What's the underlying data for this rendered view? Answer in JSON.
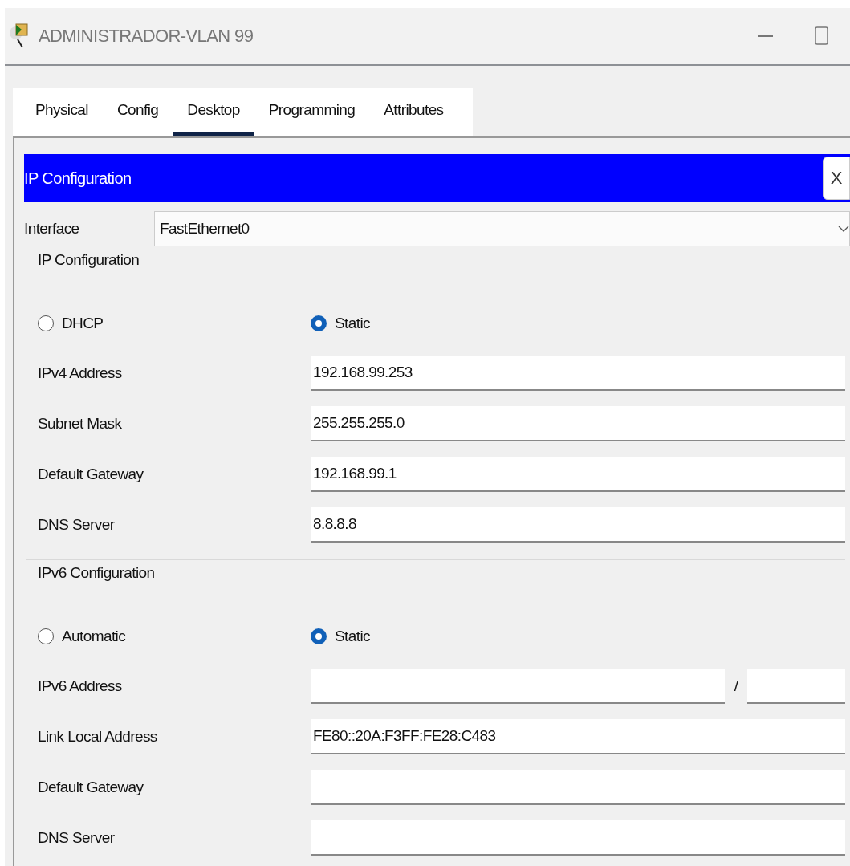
{
  "window": {
    "title": "ADMINISTRADOR-VLAN 99"
  },
  "tabs": [
    {
      "label": "Physical",
      "selected": false
    },
    {
      "label": "Config",
      "selected": false
    },
    {
      "label": "Desktop",
      "selected": true
    },
    {
      "label": "Programming",
      "selected": false
    },
    {
      "label": "Attributes",
      "selected": false
    }
  ],
  "panel": {
    "title": "IP Configuration",
    "close": "X"
  },
  "interface": {
    "label": "Interface",
    "value": "FastEthernet0"
  },
  "sections": [
    {
      "legend": "IP Configuration",
      "modes": [
        {
          "label": "DHCP",
          "selected": false
        },
        {
          "label": "Static",
          "selected": true
        }
      ],
      "fields": [
        {
          "label": "IPv4 Address",
          "kind": "text",
          "value": "192.168.99.253"
        },
        {
          "label": "Subnet Mask",
          "kind": "text",
          "value": "255.255.255.0"
        },
        {
          "label": "Default Gateway",
          "kind": "text",
          "value": "192.168.99.1"
        },
        {
          "label": "DNS Server",
          "kind": "text",
          "value": "8.8.8.8"
        }
      ]
    },
    {
      "legend": "IPv6 Configuration",
      "modes": [
        {
          "label": "Automatic",
          "selected": false
        },
        {
          "label": "Static",
          "selected": true
        }
      ],
      "fields": [
        {
          "label": "IPv6 Address",
          "kind": "prefix",
          "separator": "/"
        },
        {
          "label": "Link Local Address",
          "kind": "text",
          "value": "FE80::20A:F3FF:FE28:C483"
        },
        {
          "label": "Default Gateway",
          "kind": "text"
        },
        {
          "label": "DNS Server",
          "kind": "text"
        }
      ]
    }
  ]
}
